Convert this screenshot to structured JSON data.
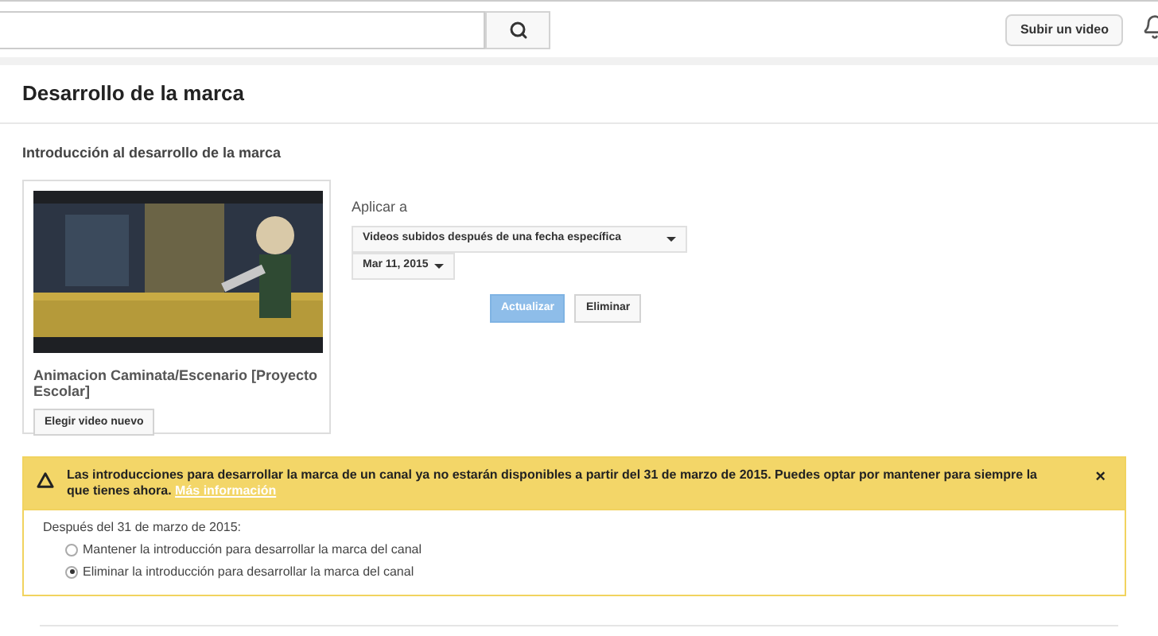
{
  "top_bar": {
    "upload_button": "Subir un video"
  },
  "page": {
    "title": "Desarrollo de la marca",
    "section_title": "Introducción al desarrollo de la marca"
  },
  "video": {
    "title": "Animacion Caminata/Escenario [Proyecto Escolar]",
    "choose_button": "Elegir video nuevo"
  },
  "apply": {
    "label": "Aplicar a",
    "scope": "Videos subidos después de una fecha específica",
    "date": "Mar 11, 2015",
    "update_button": "Actualizar",
    "update_disabled": true,
    "delete_button": "Eliminar"
  },
  "notice": {
    "message": "Las introducciones para desarrollar la marca de un canal ya no estarán disponibles a partir del 31 de marzo de 2015. Puedes optar por mantener para siempre la que tienes ahora.",
    "link": "Más información",
    "close": "×",
    "question": "Después del 31 de marzo de 2015:",
    "options": [
      {
        "label": "Mantener la introducción para desarrollar la marca del canal",
        "selected": false
      },
      {
        "label": "Eliminar la introducción para desarrollar la marca del canal",
        "selected": true
      }
    ]
  }
}
